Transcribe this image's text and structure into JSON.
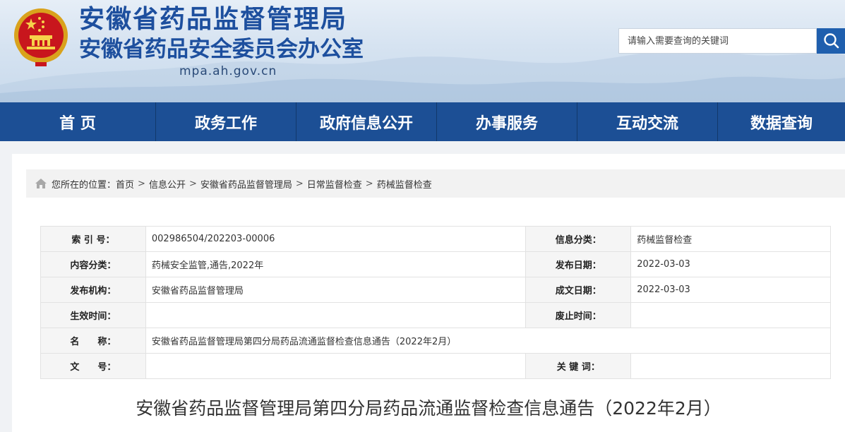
{
  "header": {
    "title": "安徽省药品监督管理局",
    "subtitle": "安徽省药品安全委员会办公室",
    "domain": "mpa.ah.gov.cn",
    "search": {
      "placeholder": "请输入需要查询的关键词",
      "value": ""
    },
    "colors": {
      "brand": "#1d4f9e",
      "nav": "#1c4f95",
      "search_button": "#1f5fae"
    }
  },
  "nav": {
    "items": [
      {
        "label": "首 页"
      },
      {
        "label": "政务工作"
      },
      {
        "label": "政府信息公开"
      },
      {
        "label": "办事服务"
      },
      {
        "label": "互动交流"
      },
      {
        "label": "数据查询"
      }
    ]
  },
  "breadcrumb": {
    "prefix": "您所在的位置：",
    "items": [
      "首页",
      "信息公开",
      "安徽省药品监督管理局",
      "日常监督检查",
      "药械监督检查"
    ],
    "separator": ">"
  },
  "meta": {
    "index_label": "索 引 号：",
    "index_value": "002986504/202203-00006",
    "info_category_label": "信息分类：",
    "info_category_value": "药械监督检查",
    "content_category_label": "内容分类：",
    "content_category_value": "药械安全监管,通告,2022年",
    "publish_date_label": "发布日期：",
    "publish_date_value": "2022-03-03",
    "publisher_label": "发布机构：",
    "publisher_value": "安徽省药品监督管理局",
    "created_date_label": "成文日期：",
    "created_date_value": "2022-03-03",
    "effective_label": "生效时间：",
    "effective_value": "",
    "abolish_label": "废止时间：",
    "abolish_value": "",
    "name_label": "名　　称：",
    "name_value": "安徽省药品监督管理局第四分局药品流通监督检查信息通告（2022年2月）",
    "doc_no_label": "文　　号：",
    "doc_no_value": "",
    "keywords_label": "关 键 词：",
    "keywords_value": ""
  },
  "article": {
    "title": "安徽省药品监督管理局第四分局药品流通监督检查信息通告（2022年2月）"
  }
}
